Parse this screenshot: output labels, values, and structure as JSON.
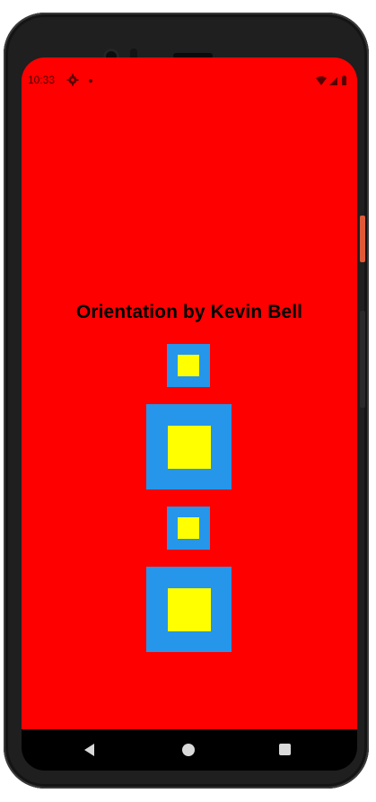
{
  "status_bar": {
    "time": "10:33",
    "icons": [
      "gear-icon",
      "notification-dot-icon",
      "wifi-icon",
      "signal-icon",
      "battery-icon"
    ]
  },
  "app": {
    "title": "Orientation by Kevin Bell",
    "background_color": "#ff0000",
    "box_outer_color": "#2596ea",
    "box_inner_color": "#ffff00",
    "boxes": [
      "small-box",
      "large-box",
      "small-box",
      "large-box"
    ]
  },
  "nav_bar": {
    "buttons": [
      "back-icon",
      "home-icon",
      "recents-icon"
    ]
  }
}
